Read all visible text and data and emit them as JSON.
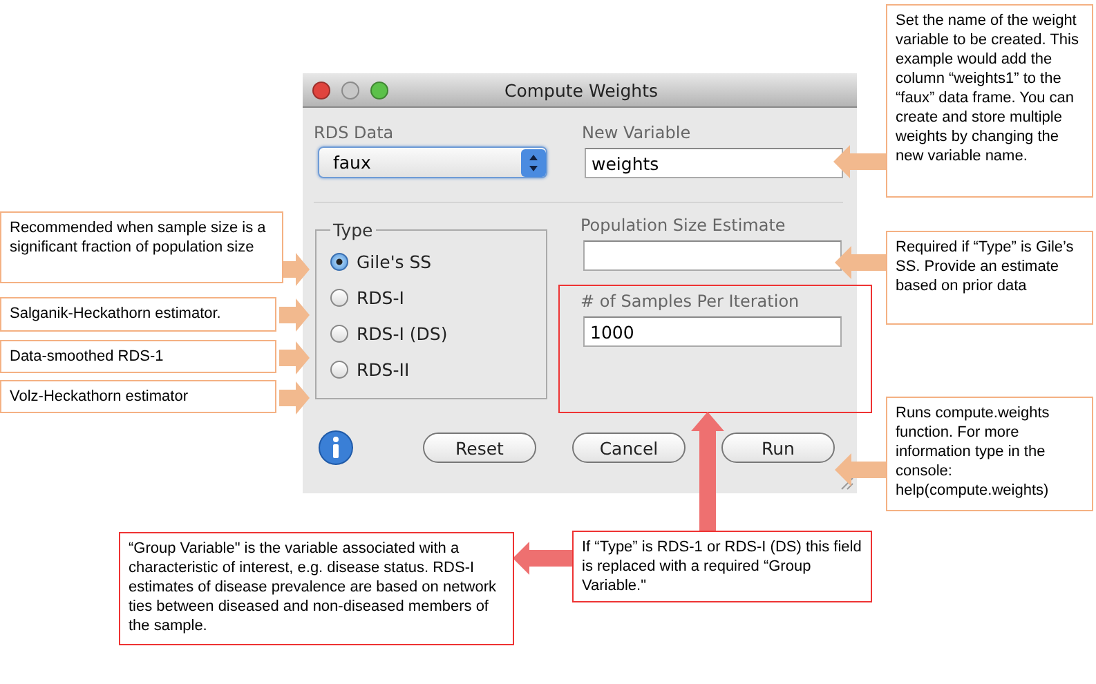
{
  "window": {
    "title": "Compute Weights"
  },
  "rds_data": {
    "label": "RDS Data",
    "value": "faux"
  },
  "new_variable": {
    "label": "New Variable",
    "value": "weights"
  },
  "type": {
    "label": "Type",
    "options": [
      {
        "label": "Gile's SS",
        "selected": true
      },
      {
        "label": "RDS-I",
        "selected": false
      },
      {
        "label": "RDS-I (DS)",
        "selected": false
      },
      {
        "label": "RDS-II",
        "selected": false
      }
    ]
  },
  "population_size_estimate": {
    "label": "Population Size Estimate"
  },
  "samples_per_iteration": {
    "label": "# of Samples Per Iteration",
    "value": "1000"
  },
  "buttons": [
    "Reset",
    "Cancel",
    "Run"
  ],
  "callouts": [
    {
      "text": "Set the name of the weight variable to be created. This example would add the column “weights1” to the “faux” data frame. You can create and store multiple weights by changing the new variable name.",
      "color": "#f4b183"
    },
    {
      "text": "Recommended when sample size is a significant fraction of population size",
      "color": "#f4b183"
    },
    {
      "text": "Salganik-Heckathorn estimator.",
      "color": "#f4b183"
    },
    {
      "text": "Data-smoothed RDS-1",
      "color": "#f4b183"
    },
    {
      "text": "Volz-Heckathorn estimator",
      "color": "#f4b183"
    },
    {
      "text": "Required if “Type” is Gile’s SS. Provide an estimate based on prior data",
      "color": "#f4b183"
    },
    {
      "text": "Runs compute.weights function. For more information type in the console: help(compute.weights)",
      "color": "#f4b183"
    },
    {
      "text": "“Group Variable\" is the variable associated with a characteristic of interest, e.g. disease status. RDS-I estimates of disease prevalence are based on network ties between diseased and non-diseased members of the sample.",
      "color": "#ee3333"
    },
    {
      "text": "If “Type” is RDS-1 or RDS-I (DS) this field is replaced with a required “Group Variable.\"",
      "color": "#ee3333"
    }
  ]
}
